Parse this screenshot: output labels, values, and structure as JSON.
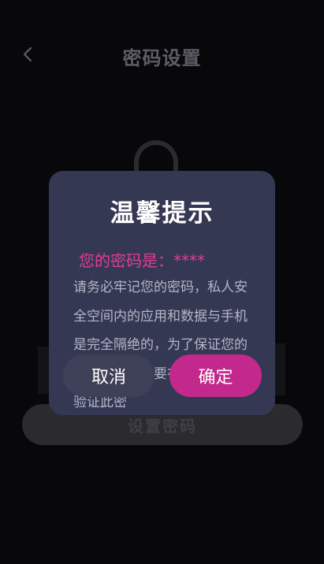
{
  "header": {
    "title": "密码设置",
    "back_icon": "chevron-left-icon"
  },
  "main": {
    "set_password_label": "设置密码"
  },
  "dialog": {
    "title": "温馨提示",
    "password_line": "您的密码是：****",
    "message": "请务必牢记您的密码，私人安全空间内的应用和数据与手机是完全隔绝的，为了保证您的安全私密，需要在应用启动时验证此密",
    "cancel_label": "取消",
    "confirm_label": "确定"
  },
  "colors": {
    "accent": "#c3298c",
    "password_text": "#e03c96",
    "dialog_bg": "#353852"
  }
}
